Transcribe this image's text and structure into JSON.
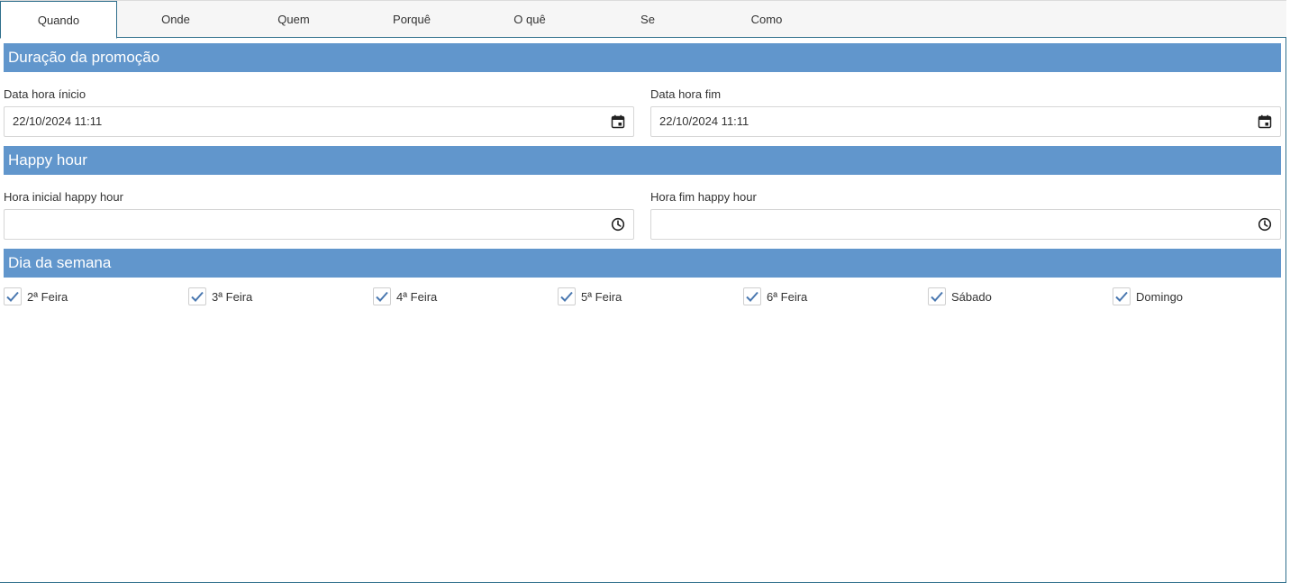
{
  "tabs": [
    {
      "label": "Quando",
      "active": true
    },
    {
      "label": "Onde",
      "active": false
    },
    {
      "label": "Quem",
      "active": false
    },
    {
      "label": "Porquê",
      "active": false
    },
    {
      "label": "O quê",
      "active": false
    },
    {
      "label": "Se",
      "active": false
    },
    {
      "label": "Como",
      "active": false
    }
  ],
  "sections": {
    "duration": {
      "title": "Duração da promoção",
      "start_label": "Data hora ínicio",
      "start_value": "22/10/2024 11:11",
      "end_label": "Data hora fim",
      "end_value": "22/10/2024 11:11"
    },
    "happy_hour": {
      "title": "Happy hour",
      "start_label": "Hora inicial happy hour",
      "start_value": "",
      "end_label": "Hora fim happy hour",
      "end_value": ""
    },
    "weekdays": {
      "title": "Dia da semana",
      "days": [
        {
          "label": "2ª Feira",
          "checked": true
        },
        {
          "label": "3ª Feira",
          "checked": true
        },
        {
          "label": "4ª Feira",
          "checked": true
        },
        {
          "label": "5ª Feira",
          "checked": true
        },
        {
          "label": "6ª Feira",
          "checked": true
        },
        {
          "label": "Sábado",
          "checked": true
        },
        {
          "label": "Domingo",
          "checked": true
        }
      ]
    }
  },
  "colors": {
    "section_bar": "#6196cc",
    "tab_border": "#2f6f8c",
    "check_mark": "#4a78b0"
  },
  "icons": {
    "date": "calendar-icon",
    "time": "clock-icon",
    "check": "checkmark-icon"
  }
}
